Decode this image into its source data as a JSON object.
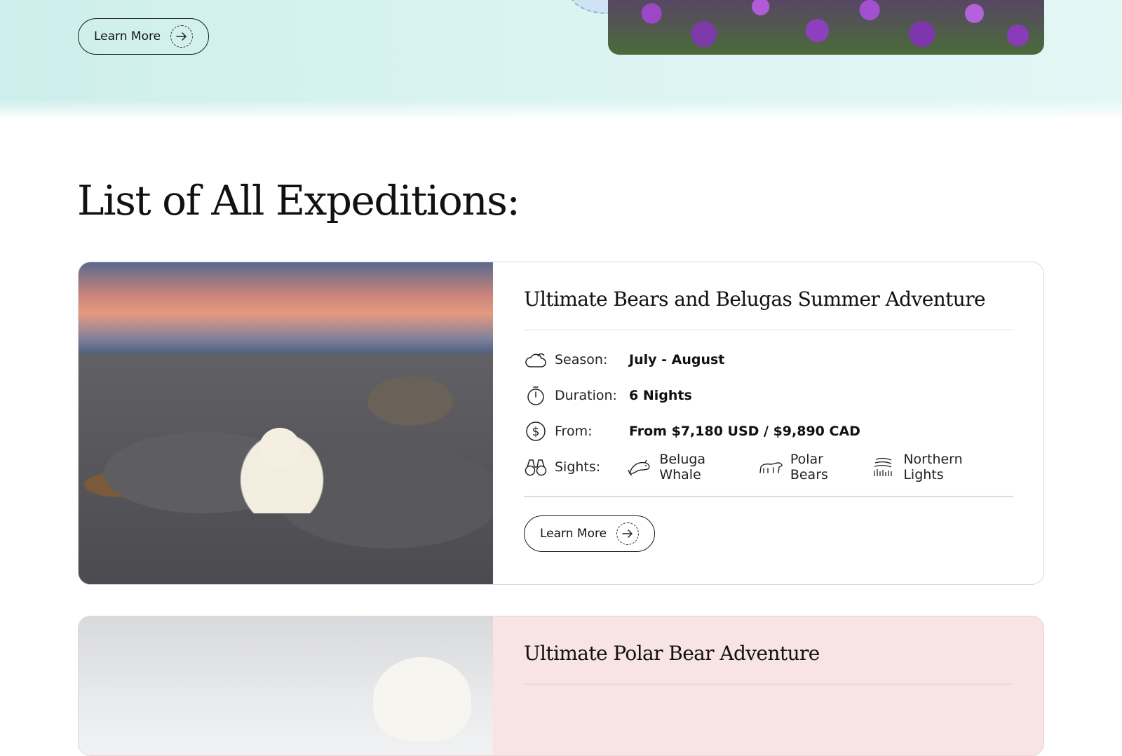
{
  "top_section": {
    "learn_more_label": "Learn More"
  },
  "section_title": "List of All Expeditions:",
  "expeditions": [
    {
      "title": "Ultimate Bears and Belugas Summer Adventure",
      "season_label": "Season:",
      "season_value": "July - August",
      "duration_label": "Duration:",
      "duration_value": "6 Nights",
      "price_label": "From:",
      "price_value": "From $7,180 USD / $9,890 CAD",
      "sights_label": "Sights:",
      "sights": [
        "Beluga Whale",
        "Polar Bears",
        "Northern Lights"
      ],
      "learn_more_label": "Learn More"
    },
    {
      "title": "Ultimate Polar Bear Adventure"
    }
  ],
  "icons": {
    "season": "cloud-sun-icon",
    "duration": "stopwatch-icon",
    "price": "dollar-circle-icon",
    "sights": "binoculars-icon",
    "sight_icons": [
      "beluga-icon",
      "polar-bear-icon",
      "northern-lights-icon"
    ],
    "button": "arrow-right-circle-icon"
  }
}
